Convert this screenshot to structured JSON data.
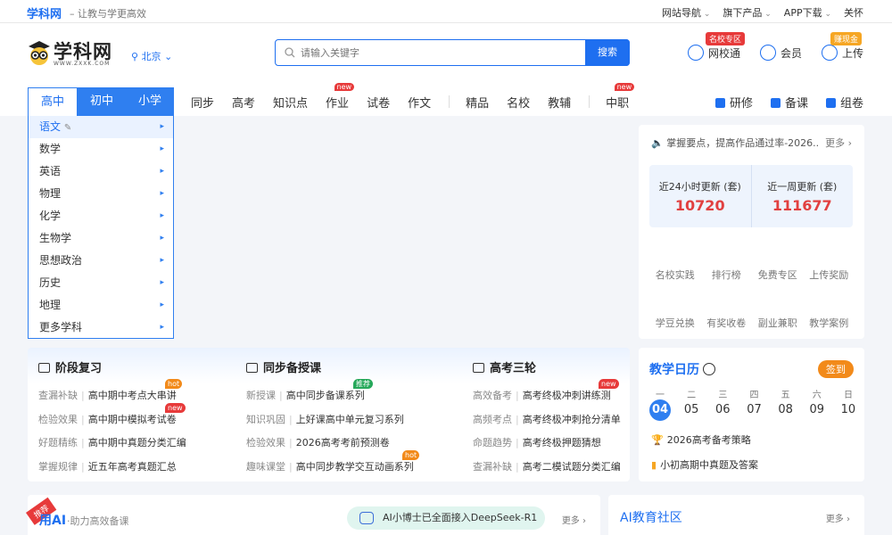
{
  "topbar": {
    "brand": "学科网",
    "slogan": "– 让教与学更高效",
    "links": [
      "网站导航",
      "旗下产品",
      "APP下载",
      "关怀"
    ]
  },
  "header": {
    "logo_name": "学科网",
    "logo_url": "WWW.ZXXK.COM",
    "city": "北京",
    "search_placeholder": "请输入关键字",
    "search_button": "搜索",
    "icons": [
      {
        "label": "网校通",
        "tag": "名校专区"
      },
      {
        "label": "会员",
        "tag": ""
      },
      {
        "label": "上传",
        "tag": "赚现金"
      }
    ]
  },
  "nav": {
    "levels": [
      "高中",
      "初中",
      "小学"
    ],
    "items": [
      {
        "label": "同步",
        "badge": ""
      },
      {
        "label": "高考",
        "badge": ""
      },
      {
        "label": "知识点",
        "badge": ""
      },
      {
        "label": "作业",
        "badge": "new"
      },
      {
        "label": "试卷",
        "badge": ""
      },
      {
        "label": "作文",
        "badge": ""
      },
      {
        "label": "精品",
        "badge": ""
      },
      {
        "label": "名校",
        "badge": ""
      },
      {
        "label": "教辅",
        "badge": ""
      },
      {
        "label": "中职",
        "badge": "new"
      }
    ],
    "right": [
      "研修",
      "备课",
      "组卷"
    ]
  },
  "subjects": [
    "语文",
    "数学",
    "英语",
    "物理",
    "化学",
    "生物学",
    "思想政治",
    "历史",
    "地理",
    "更多学科"
  ],
  "right_top": {
    "notice": "掌握要点，提高作品通过率-2026...",
    "notice_more": "更多 ›",
    "stat_labels": [
      "近24小时更新 (套)",
      "近一周更新 (套)"
    ],
    "stat_values": [
      "10720",
      "111677"
    ],
    "quick_links": [
      "名校实践",
      "排行榜",
      "免费专区",
      "上传奖励",
      "学豆兑换",
      "有奖收卷",
      "副业兼职",
      "教学案例"
    ]
  },
  "panel": {
    "columns": [
      {
        "title": "阶段复习",
        "rows": [
          {
            "k": "查漏补缺",
            "v": "高中期中考点大串讲",
            "badge": "hot"
          },
          {
            "k": "检验效果",
            "v": "高中期中模拟考试卷",
            "badge": "new"
          },
          {
            "k": "好题精练",
            "v": "高中期中真题分类汇编",
            "badge": ""
          },
          {
            "k": "掌握规律",
            "v": "近五年高考真题汇总",
            "badge": ""
          }
        ]
      },
      {
        "title": "同步备授课",
        "rows": [
          {
            "k": "新授课",
            "v": "高中同步备课系列",
            "badge": "推荐"
          },
          {
            "k": "知识巩固",
            "v": "上好课高中单元复习系列",
            "badge": ""
          },
          {
            "k": "检验效果",
            "v": "2026高考考前预测卷",
            "badge": ""
          },
          {
            "k": "趣味课堂",
            "v": "高中同步教学交互动画系列",
            "badge": "hot"
          }
        ]
      },
      {
        "title": "高考三轮",
        "rows": [
          {
            "k": "高效备考",
            "v": "高考终极冲刺讲练测",
            "badge": "new"
          },
          {
            "k": "高频考点",
            "v": "高考终极冲刺抢分清单",
            "badge": ""
          },
          {
            "k": "命题趋势",
            "v": "高考终极押题猜想",
            "badge": ""
          },
          {
            "k": "查漏补缺",
            "v": "高考二模试题分类汇编",
            "badge": ""
          }
        ]
      }
    ]
  },
  "calendar": {
    "title": "教学日历",
    "sign": "签到",
    "weekdays": [
      "一",
      "二",
      "三",
      "四",
      "五",
      "六",
      "日"
    ],
    "dates": [
      "04",
      "05",
      "06",
      "07",
      "08",
      "09",
      "10"
    ],
    "events": [
      "2026高考备考策略",
      "小初高期中真题及答案"
    ]
  },
  "ai": {
    "recommend": "推荐",
    "title": "用AI",
    "subtitle": "·助力高效备课",
    "pill": "AI小博士已全面接入DeepSeek-R1",
    "more": "更多 ›"
  },
  "community": {
    "title": "AI教育社区",
    "more": "更多 ›"
  },
  "colors": {
    "accent": "#1e6ff0",
    "highlight": "#e14040",
    "orange": "#f28a1a"
  }
}
